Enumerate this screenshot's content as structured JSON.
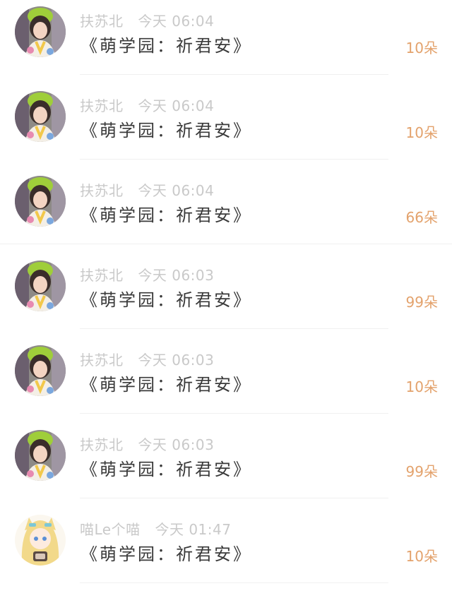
{
  "gifts": [
    {
      "user": "扶苏北",
      "day": "今天",
      "time": "06:04",
      "message": "《萌学园：祈君安》",
      "amount": "10朵",
      "avatar": "girl-avatar"
    },
    {
      "user": "扶苏北",
      "day": "今天",
      "time": "06:04",
      "message": "《萌学园：祈君安》",
      "amount": "10朵",
      "avatar": "girl-avatar"
    },
    {
      "user": "扶苏北",
      "day": "今天",
      "time": "06:04",
      "message": "《萌学园：祈君安》",
      "amount": "66朵",
      "avatar": "girl-avatar"
    },
    {
      "user": "扶苏北",
      "day": "今天",
      "time": "06:03",
      "message": "《萌学园：祈君安》",
      "amount": "99朵",
      "avatar": "girl-avatar"
    },
    {
      "user": "扶苏北",
      "day": "今天",
      "time": "06:03",
      "message": "《萌学园：祈君安》",
      "amount": "10朵",
      "avatar": "girl-avatar"
    },
    {
      "user": "扶苏北",
      "day": "今天",
      "time": "06:03",
      "message": "《萌学园：祈君安》",
      "amount": "99朵",
      "avatar": "girl-avatar"
    },
    {
      "user": "喵Le个喵",
      "day": "今天",
      "time": "01:47",
      "message": "《萌学园：祈君安》",
      "amount": "10朵",
      "avatar": "anime-avatar"
    }
  ],
  "colors": {
    "meta": "#c9c9c9",
    "message": "#3a3a3a",
    "amount": "#e3a26c",
    "divider": "#f0f0f0"
  }
}
